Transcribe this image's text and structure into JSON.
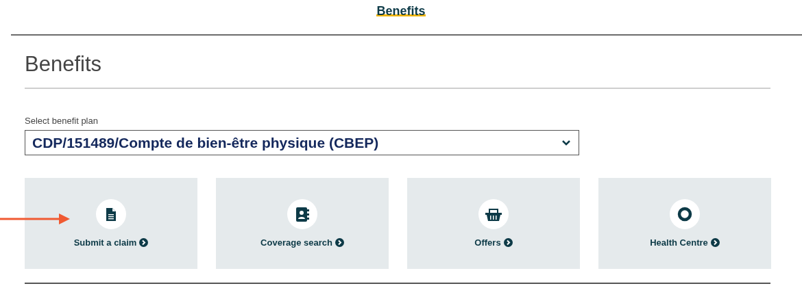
{
  "nav": {
    "tabs": [
      {
        "label": "Benefits",
        "selected": true
      }
    ]
  },
  "page": {
    "title": "Benefits"
  },
  "plan_select": {
    "label": "Select benefit plan",
    "value": "CDP/151489/Compte de bien-être physique (CBEP)"
  },
  "tiles": [
    {
      "kind": "document",
      "label": "Submit a claim",
      "highlighted": true
    },
    {
      "kind": "contact",
      "label": "Coverage search",
      "highlighted": false
    },
    {
      "kind": "basket",
      "label": "Offers",
      "highlighted": false
    },
    {
      "kind": "ring",
      "label": "Health Centre",
      "highlighted": false
    }
  ]
}
